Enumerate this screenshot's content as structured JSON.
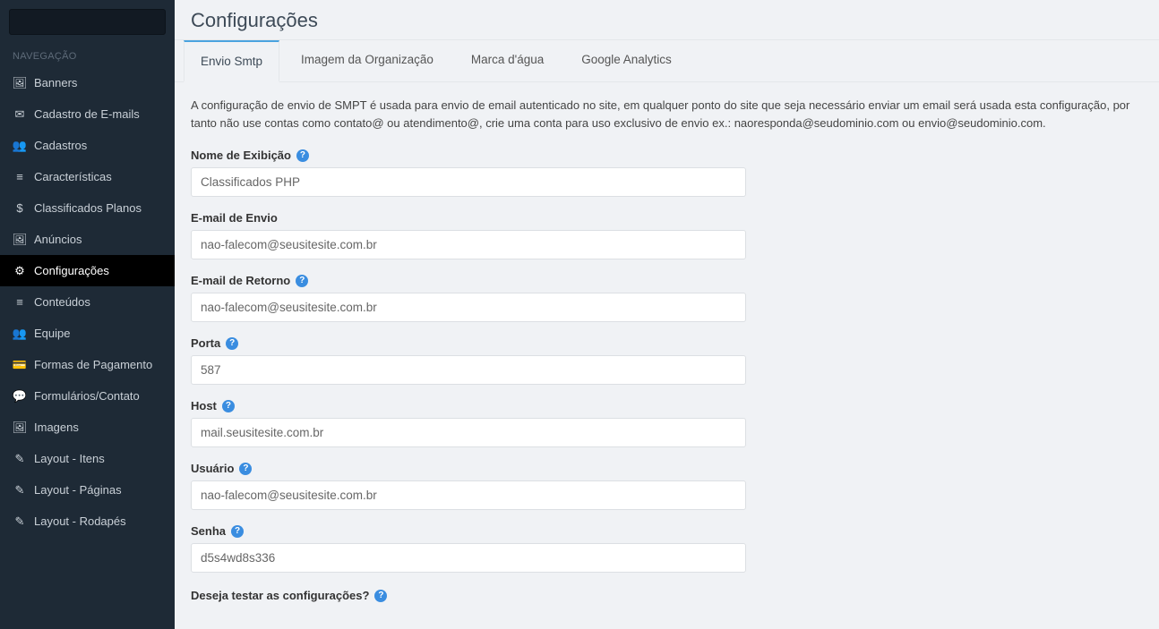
{
  "sidebar": {
    "heading": "NAVEGAÇÃO",
    "items": [
      {
        "icon": "images-icon",
        "glyph": "🖼",
        "label": "Banners",
        "active": false
      },
      {
        "icon": "envelope-icon",
        "glyph": "✉",
        "label": "Cadastro de E-mails",
        "active": false
      },
      {
        "icon": "users-icon",
        "glyph": "👥",
        "label": "Cadastros",
        "active": false
      },
      {
        "icon": "list-icon",
        "glyph": "≡",
        "label": "Características",
        "active": false
      },
      {
        "icon": "dollar-icon",
        "glyph": "$",
        "label": "Classificados Planos",
        "active": false
      },
      {
        "icon": "images-icon",
        "glyph": "🖼",
        "label": "Anúncios",
        "active": false
      },
      {
        "icon": "cogs-icon",
        "glyph": "⚙",
        "label": "Configurações",
        "active": true
      },
      {
        "icon": "list-icon",
        "glyph": "≡",
        "label": "Conteúdos",
        "active": false
      },
      {
        "icon": "users-icon",
        "glyph": "👥",
        "label": "Equipe",
        "active": false
      },
      {
        "icon": "credit-card-icon",
        "glyph": "💳",
        "label": "Formas de Pagamento",
        "active": false
      },
      {
        "icon": "comment-icon",
        "glyph": "💬",
        "label": "Formulários/Contato",
        "active": false
      },
      {
        "icon": "image-icon",
        "glyph": "🖼",
        "label": "Imagens",
        "active": false
      },
      {
        "icon": "pencil-icon",
        "glyph": "✎",
        "label": "Layout - Itens",
        "active": false
      },
      {
        "icon": "pencil-icon",
        "glyph": "✎",
        "label": "Layout - Páginas",
        "active": false
      },
      {
        "icon": "pencil-icon",
        "glyph": "✎",
        "label": "Layout - Rodapés",
        "active": false
      }
    ]
  },
  "header": {
    "title": "Configurações"
  },
  "tabs": [
    {
      "label": "Envio Smtp",
      "active": true
    },
    {
      "label": "Imagem da Organização",
      "active": false
    },
    {
      "label": "Marca d'água",
      "active": false
    },
    {
      "label": "Google Analytics",
      "active": false
    }
  ],
  "intro": "A configuração de envio de SMPT é usada para envio de email autenticado no site, em qualquer ponto do site que seja necessário enviar um email será usada esta configuração, por tanto não use contas como contato@ ou atendimento@, crie uma conta para uso exclusivo de envio ex.: naoresponda@seudominio.com ou envio@seudominio.com.",
  "form": {
    "display_name": {
      "label": "Nome de Exibição",
      "help": true,
      "value": "Classificados PHP"
    },
    "send_email": {
      "label": "E-mail de Envio",
      "help": false,
      "value": "nao-falecom@seusitesite.com.br"
    },
    "return_email": {
      "label": "E-mail de Retorno",
      "help": true,
      "value": "nao-falecom@seusitesite.com.br"
    },
    "port": {
      "label": "Porta",
      "help": true,
      "value": "587"
    },
    "host": {
      "label": "Host",
      "help": true,
      "value": "mail.seusitesite.com.br"
    },
    "user": {
      "label": "Usuário",
      "help": true,
      "value": "nao-falecom@seusitesite.com.br"
    },
    "password": {
      "label": "Senha",
      "help": true,
      "value": "d5s4wd8s336"
    },
    "test_label": "Deseja testar as configurações?"
  },
  "colors": {
    "accent": "#4aa3df",
    "help": "#3a8de0"
  }
}
